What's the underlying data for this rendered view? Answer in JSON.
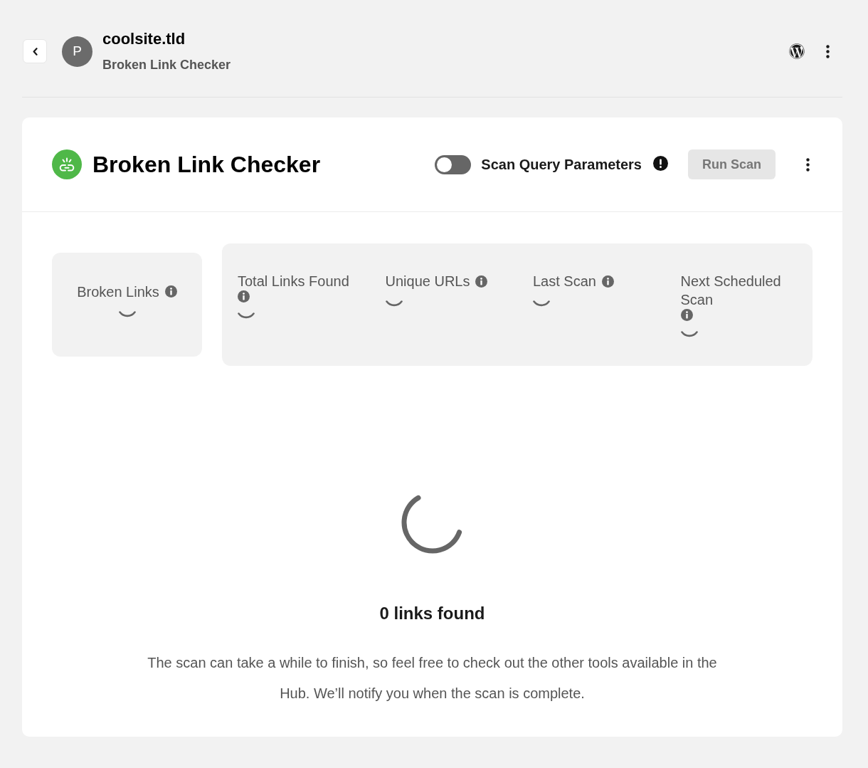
{
  "site": {
    "avatar_letter": "P",
    "name": "coolsite.tld",
    "subtitle": "Broken Link Checker"
  },
  "tool": {
    "title": "Broken Link Checker",
    "scan_query_parameters": {
      "label": "Scan Query Parameters",
      "on": false
    },
    "run_scan": {
      "label": "Run Scan",
      "disabled": true
    }
  },
  "stats": {
    "primary": {
      "label": "Broken Links",
      "loading": true
    },
    "secondary": [
      {
        "label": "Total Links Found",
        "loading": true
      },
      {
        "label": "Unique URLs",
        "loading": true
      },
      {
        "label": "Last Scan",
        "loading": true
      },
      {
        "label": "Next Scheduled Scan",
        "loading": true
      }
    ]
  },
  "scan": {
    "loading": true,
    "status": "0 links found",
    "message": "The scan can take a while to finish, so feel free to check out the other tools available in the Hub. We’ll notify you when the scan is complete."
  }
}
